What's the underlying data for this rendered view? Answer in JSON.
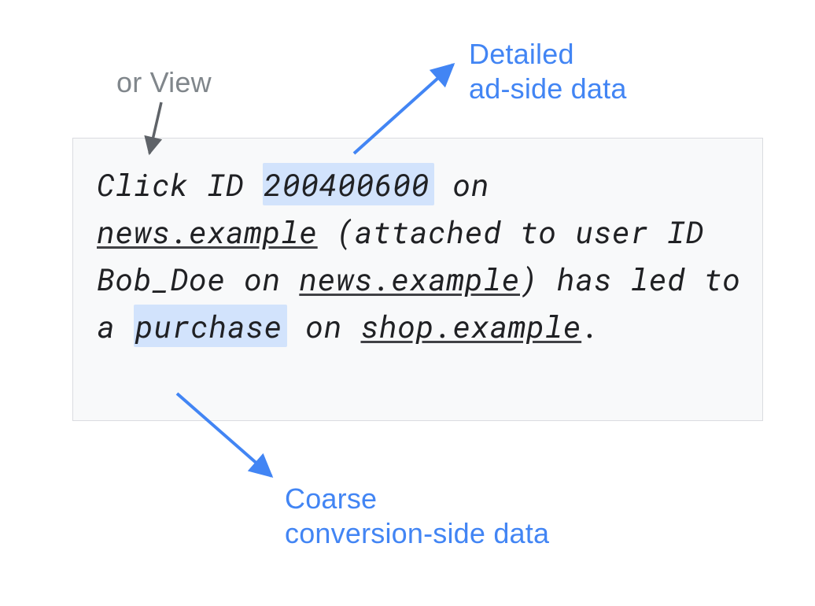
{
  "annotations": {
    "or_view": "or View",
    "detailed": "Detailed\nad-side data",
    "coarse": "Coarse\nconversion-side data"
  },
  "sentence": {
    "p1": "Click ID ",
    "click_id": "200400600",
    "p2": " on ",
    "site1": "news.example",
    "p3": " (attached to user ID Bob_Doe on ",
    "site1b": "news.example",
    "p4": ") has led to a ",
    "purchase": "purchase",
    "p5": " on ",
    "site2": "shop.example",
    "p6": "."
  }
}
